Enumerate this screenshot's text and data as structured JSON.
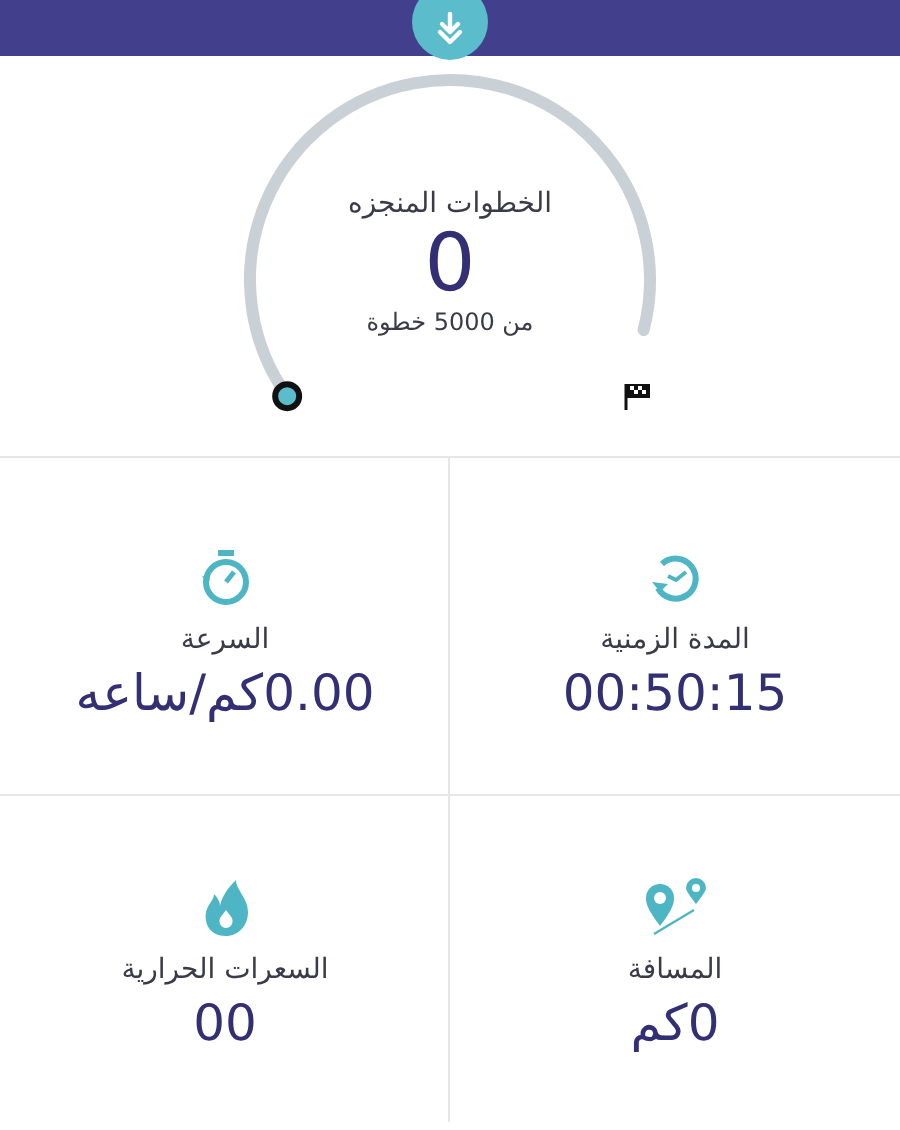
{
  "goal": {
    "title": "الخطوات المنجزه",
    "value": "0",
    "subtitle": "من 5000 خطوة"
  },
  "stats": [
    {
      "kind": "duration",
      "label": "المدة الزمنية",
      "value": "00:50:15"
    },
    {
      "kind": "speed",
      "label": "السرعة",
      "value": "0.00كم/ساعه"
    },
    {
      "kind": "distance",
      "label": "المسافة",
      "value": "0كم"
    },
    {
      "kind": "calories",
      "label": "السعرات الحرارية",
      "value": "00"
    }
  ]
}
